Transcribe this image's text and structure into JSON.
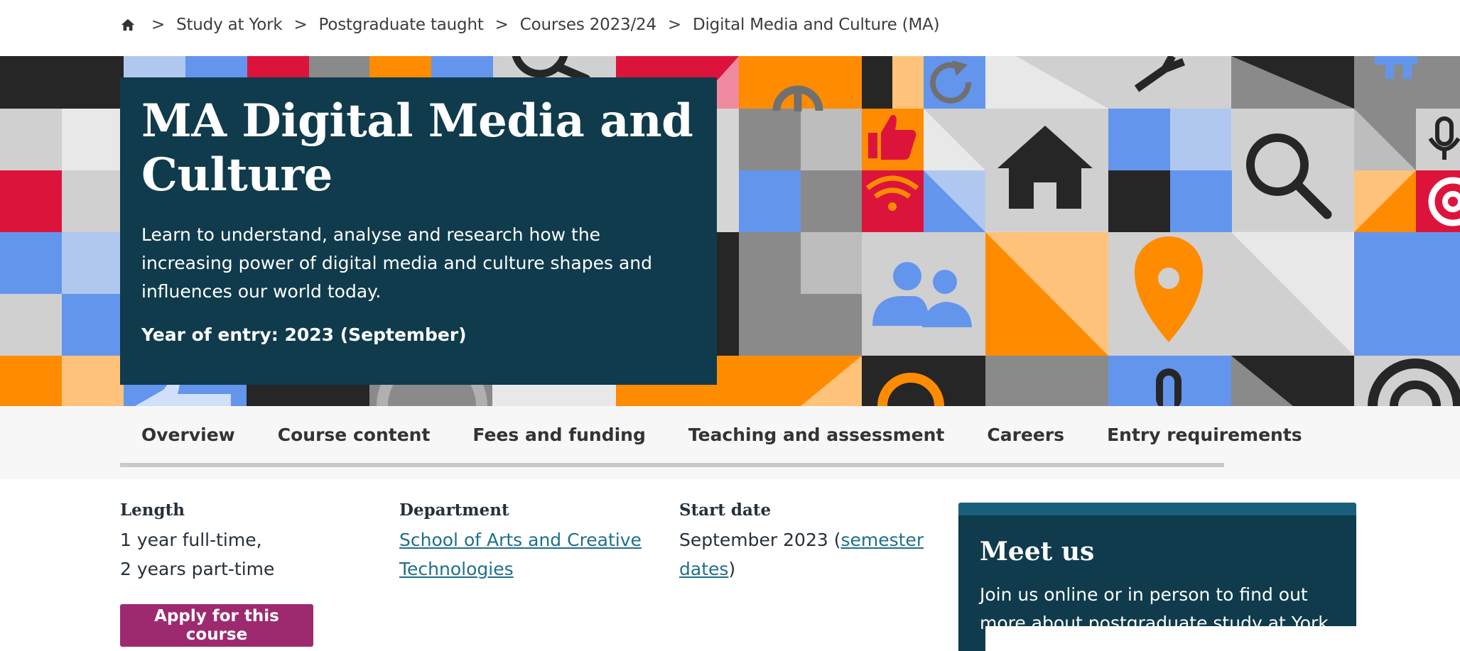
{
  "breadcrumb": {
    "items": [
      "Study at York",
      "Postgraduate taught",
      "Courses 2023/24",
      "Digital Media and Culture (MA)"
    ],
    "separator": ">"
  },
  "hero": {
    "title": "MA Digital Media and Culture",
    "description": "Learn to understand, analyse and research how the increasing power of digital media and culture shapes and influences our world today.",
    "year_of_entry": "Year of entry: 2023 (September)"
  },
  "tabs": [
    "Overview",
    "Course content",
    "Fees and funding",
    "Teaching and assessment",
    "Careers",
    "Entry requirements"
  ],
  "info": {
    "length_label": "Length",
    "length_line1": "1 year full-time,",
    "length_line2": "2 years part-time",
    "department_label": "Department",
    "department_link": "School of Arts and Creative Technologies",
    "start_label": "Start date",
    "start_text": "September 2023 (",
    "start_link": "semester dates",
    "start_suffix": ")"
  },
  "apply_button": "Apply for this course",
  "meet_us": {
    "title": "Meet us",
    "text": "Join us online or in person to find out more about postgraduate study at York."
  },
  "colors": {
    "card_bg": "#0f3b4c",
    "apply": "#9d2a6f",
    "link": "#1f6f8b",
    "orange": "#ff8c00",
    "blue": "#6495ed",
    "red": "#dc143c"
  },
  "icons": [
    "home-icon",
    "search-icon",
    "refresh-icon",
    "thumbs-up-icon",
    "wifi-icon",
    "house-icon",
    "microphone-icon",
    "at-sign-icon",
    "people-icon",
    "location-pin-icon"
  ]
}
